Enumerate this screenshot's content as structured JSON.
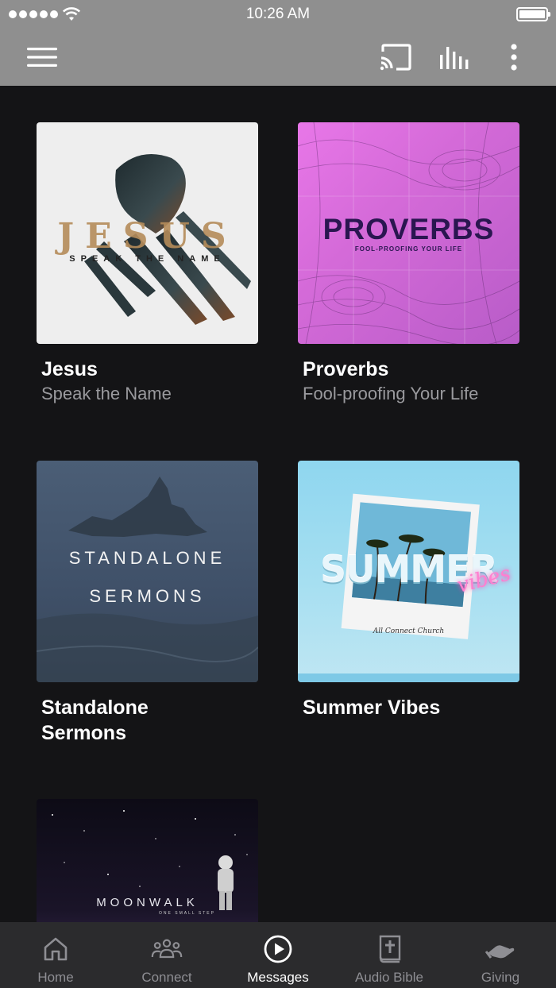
{
  "status_bar": {
    "time": "10:26 AM"
  },
  "toolbar": {
    "menu_icon": "hamburger-menu-icon",
    "cast_icon": "cast-icon",
    "equalizer_icon": "equalizer-icon",
    "more_icon": "more-vertical-icon"
  },
  "series": [
    {
      "title": "Jesus",
      "subtitle": "Speak the Name",
      "artwork": {
        "headline": "JESUS",
        "tagline": "SPEAK THE NAME"
      }
    },
    {
      "title": "Proverbs",
      "subtitle": "Fool-proofing Your Life",
      "artwork": {
        "headline": "PROVERBS",
        "tagline": "FOOL-PROOFING YOUR LIFE"
      }
    },
    {
      "title": "Standalone\nSermons",
      "subtitle": "",
      "artwork": {
        "line1": "STANDALONE",
        "line2": "SERMONS"
      }
    },
    {
      "title": "Summer Vibes",
      "subtitle": "",
      "artwork": {
        "headline": "SUMMER",
        "script": "vibes",
        "caption": "All Connect Church"
      }
    },
    {
      "title": "",
      "subtitle": "",
      "artwork": {
        "headline": "MOONWALK",
        "tagline": "ONE SMALL STEP"
      }
    }
  ],
  "tabbar": {
    "tabs": [
      {
        "label": "Home",
        "icon": "home-icon",
        "active": false
      },
      {
        "label": "Connect",
        "icon": "people-group-icon",
        "active": false
      },
      {
        "label": "Messages",
        "icon": "play-circle-icon",
        "active": true
      },
      {
        "label": "Audio Bible",
        "icon": "bible-cross-icon",
        "active": false
      },
      {
        "label": "Giving",
        "icon": "giving-hand-icon",
        "active": false
      }
    ]
  },
  "colors": {
    "toolbar_bg": "#8f8f8f",
    "content_bg": "#141416",
    "tabbar_bg": "#2b2b2d",
    "tab_active": "#ffffff",
    "tab_inactive": "#8e8e93",
    "subtitle": "#9a9a9e"
  }
}
